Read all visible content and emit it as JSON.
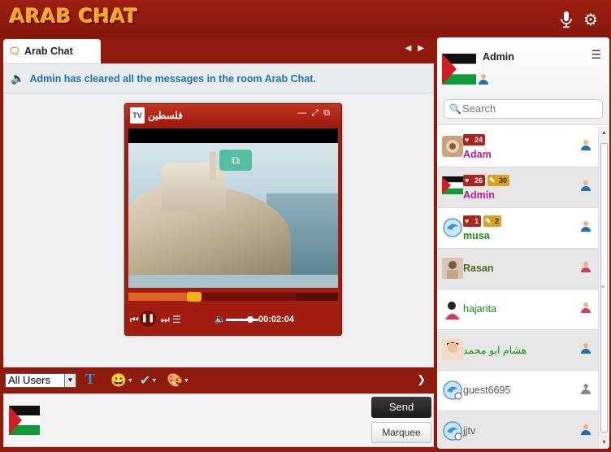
{
  "app": {
    "logo": "ARAB CHAT"
  },
  "room": {
    "tab_label": "Arab Chat",
    "notice": "Admin has cleared all the messages in the room Arab Chat."
  },
  "player": {
    "title": "فلسطين",
    "logo_text": "TV",
    "time": "00:02:04",
    "progress": 0.31,
    "buffered": 0.8,
    "volume": 0.75
  },
  "toolbar": {
    "user_select": "All Users",
    "text_format": "T"
  },
  "input": {
    "send_label": "Send",
    "marquee_label": "Marquee"
  },
  "sidebar": {
    "current_user": "Admin",
    "search_placeholder": "Search",
    "users": [
      {
        "name": "Adam",
        "color": "#c0189a",
        "badges": [
          {
            "type": "red",
            "value": "24"
          }
        ],
        "status": "male"
      },
      {
        "name": "Admin",
        "color": "#c0189a",
        "badges": [
          {
            "type": "red",
            "value": "26"
          },
          {
            "type": "gold",
            "value": "30"
          }
        ],
        "status": "male"
      },
      {
        "name": "musa",
        "color": "#1e8a1e",
        "badges": [
          {
            "type": "red",
            "value": "1"
          },
          {
            "type": "gold",
            "value": "2"
          }
        ],
        "status": "male"
      },
      {
        "name": "Rasan",
        "color": "#4b6a1e",
        "badges": [],
        "status": "female"
      },
      {
        "name": "hajarita",
        "color": "#1e8a1e",
        "badges": [],
        "status": "female"
      },
      {
        "name": "هشام ابو محمد",
        "color": "#1e8a1e",
        "badges": [],
        "status": "male"
      },
      {
        "name": "guest6695",
        "color": "#555555",
        "badges": [],
        "status": "guest"
      },
      {
        "name": "jjtv",
        "color": "#555555",
        "badges": [],
        "status": "male"
      }
    ]
  },
  "colors": {
    "brand": "#8f1a0e",
    "accent": "#f7a21d",
    "notice": "#1f6fb5"
  }
}
